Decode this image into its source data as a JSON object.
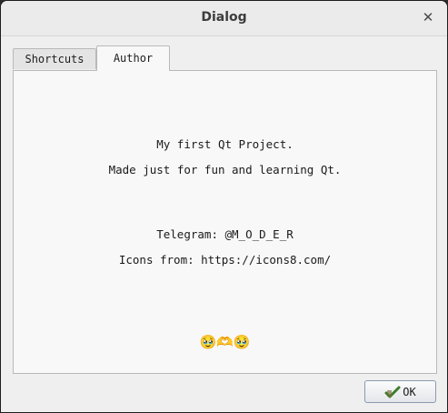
{
  "window": {
    "title": "Dialog",
    "close_glyph": "✕"
  },
  "tabs": [
    {
      "label": "Shortcuts",
      "active": false
    },
    {
      "label": "Author",
      "active": true
    }
  ],
  "author": {
    "line1": "My first Qt Project.",
    "line2": "Made just for fun and learning Qt.",
    "line3": "Telegram: @M_O_D_E_R",
    "line4": "Icons from: https://icons8.com/",
    "emoji": "🥹🫶🥹"
  },
  "buttons": {
    "ok_label": "OK",
    "ok_icon": "ok-check-icon"
  },
  "colors": {
    "tab_active": "#f8f8f8",
    "panel_bg": "#f8f8f8",
    "button_border": "#8a9ab0"
  }
}
